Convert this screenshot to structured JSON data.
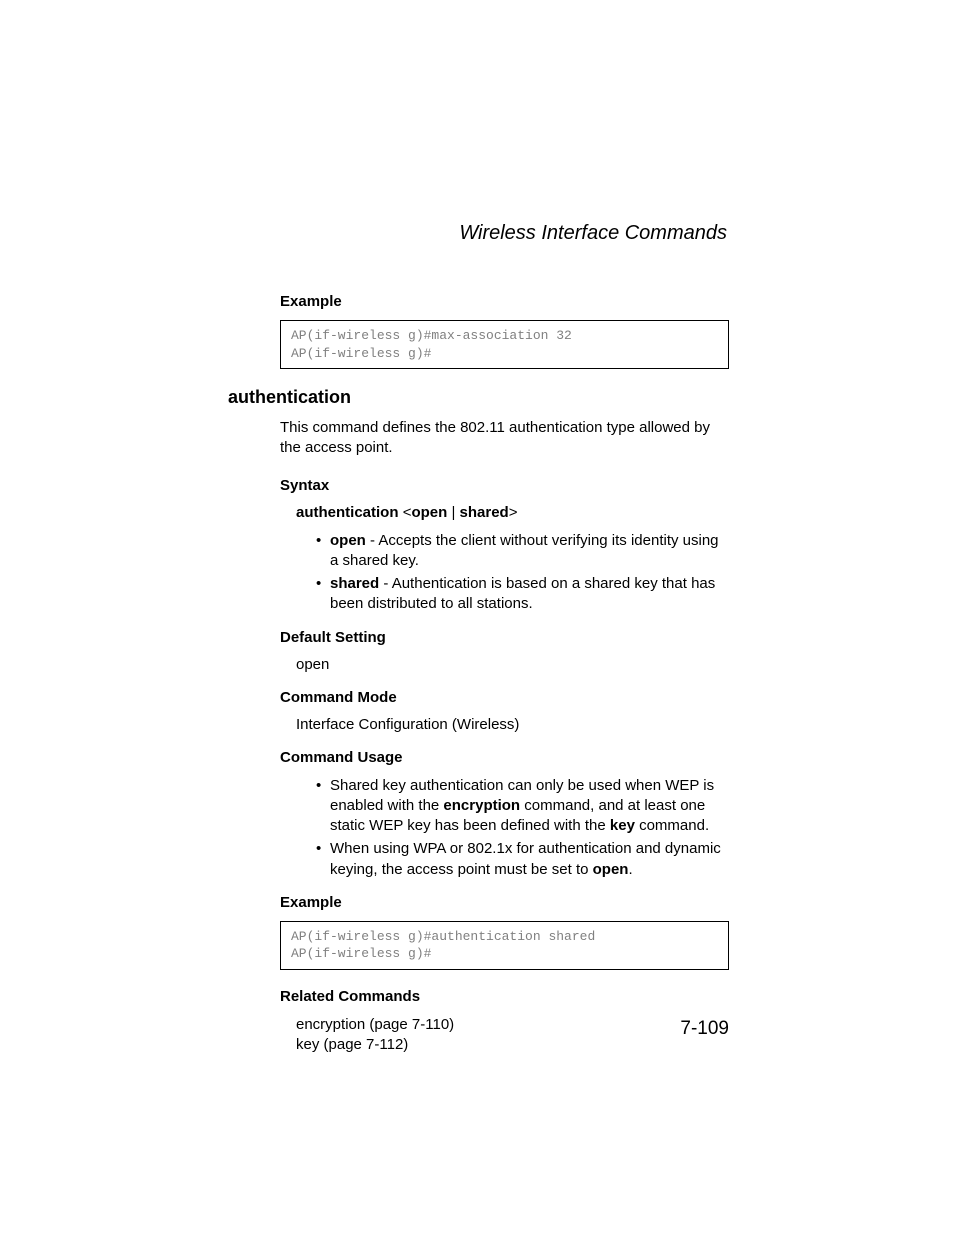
{
  "header": {
    "title": "Wireless Interface Commands"
  },
  "example1": {
    "label": "Example",
    "code": "AP(if-wireless g)#max-association 32\nAP(if-wireless g)#"
  },
  "command": {
    "name": "authentication",
    "description": "This command defines the 802.11 authentication type allowed by the access point."
  },
  "syntax": {
    "label": "Syntax",
    "prefix": "authentication",
    "lt": "<",
    "opt1": "open",
    "sep": " | ",
    "opt2": "shared",
    "gt": ">",
    "items": {
      "open_label": "open",
      "open_desc": " - Accepts the client without verifying its identity using a shared key.",
      "shared_label": "shared",
      "shared_desc": " - Authentication is based on a shared key that has been distributed to all stations."
    }
  },
  "default_setting": {
    "label": "Default Setting",
    "value": "open"
  },
  "command_mode": {
    "label": "Command Mode",
    "value": "Interface Configuration (Wireless)"
  },
  "command_usage": {
    "label": "Command Usage",
    "item1_a": "Shared key authentication can only be used when WEP is enabled with the ",
    "item1_b": "encryption",
    "item1_c": " command, and at least one static WEP key has been defined with the ",
    "item1_d": "key",
    "item1_e": " command.",
    "item2_a": "When using WPA or 802.1x for authentication and dynamic keying, the access point must be set to ",
    "item2_b": "open",
    "item2_c": "."
  },
  "example2": {
    "label": "Example",
    "code": "AP(if-wireless g)#authentication shared\nAP(if-wireless g)#"
  },
  "related": {
    "label": "Related Commands",
    "line1": "encryption (page 7-110)",
    "line2": "key (page 7-112)"
  },
  "page_number": "7-109"
}
